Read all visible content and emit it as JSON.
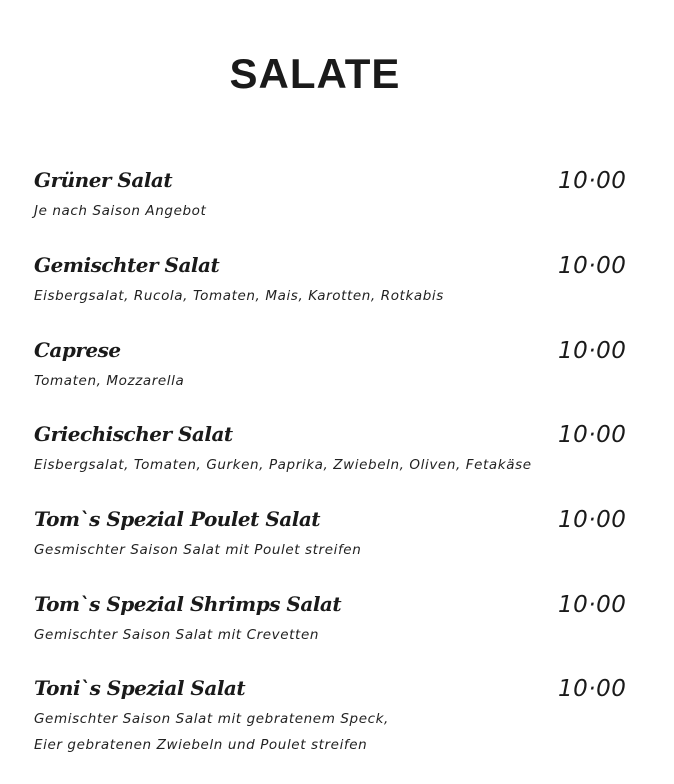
{
  "title": "SALATE",
  "items": [
    {
      "name": "Grüner Salat",
      "price": "10·00",
      "desc": [
        "Je nach Saison Angebot"
      ]
    },
    {
      "name": "Gemischter Salat",
      "price": "10·00",
      "desc": [
        "Eisbergsalat, Rucola, Tomaten, Mais, Karotten, Rotkabis"
      ]
    },
    {
      "name": "Caprese",
      "price": "10·00",
      "desc": [
        "Tomaten, Mozzarella"
      ]
    },
    {
      "name": "Griechischer Salat",
      "price": "10·00",
      "desc": [
        "Eisbergsalat, Tomaten, Gurken, Paprika, Zwiebeln, Oliven, Fetakäse"
      ]
    },
    {
      "name": "Tom`s Spezial Poulet Salat",
      "price": "10·00",
      "desc": [
        "Gesmischter Saison Salat mit Poulet streifen"
      ]
    },
    {
      "name": "Tom`s Spezial Shrimps Salat",
      "price": "10·00",
      "desc": [
        "Gemischter Saison Salat mit Crevetten"
      ]
    },
    {
      "name": "Toni`s Spezial Salat",
      "price": "10·00",
      "desc": [
        "Gemischter Saison Salat mit gebratenem Speck,",
        "Eier gebratenen Zwiebeln und Poulet streifen"
      ]
    }
  ]
}
